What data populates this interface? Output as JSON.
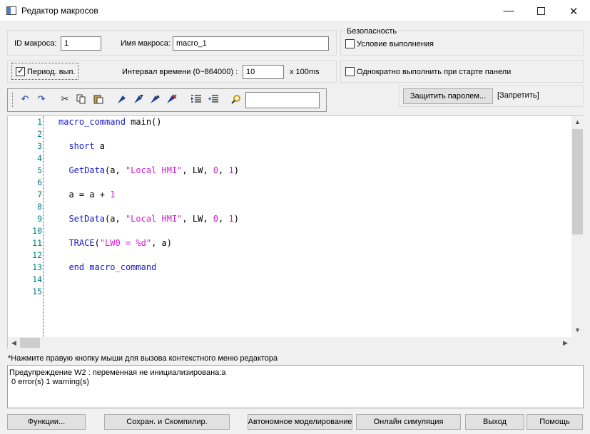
{
  "window": {
    "title": "Редактор макросов",
    "controls": {
      "minimize": "—",
      "close": "✕"
    }
  },
  "macro": {
    "id_label": "ID макроса:",
    "id_value": "1",
    "name_label": "Имя макроса:",
    "name_value": "macro_1",
    "periodic_label": "Период. вып.",
    "periodic_checked": true,
    "interval_label": "Интервал времени (0~864000) :",
    "interval_value": "10",
    "interval_unit": "x 100ms"
  },
  "security": {
    "title": "Безопасность",
    "condition_label": "Условие выполнения",
    "run_once_label": "Однократно выполнить при старте панели",
    "password_button": "Защитить паролем...",
    "status": "[Запретить]"
  },
  "toolbar": {
    "search_value": "",
    "icons": [
      "undo-icon",
      "redo-icon",
      "cut-icon",
      "copy-icon",
      "paste-icon",
      "bookmark-toggle-icon",
      "bookmark-next-icon",
      "bookmark-clear-icon",
      "indent-icon",
      "outdent-icon",
      "find-icon"
    ]
  },
  "editor": {
    "line_numbers": [
      "1",
      "2",
      "3",
      "4",
      "5",
      "6",
      "7",
      "8",
      "9",
      "10",
      "11",
      "12",
      "13",
      "14",
      "15"
    ],
    "lines": [
      "macro_command main()",
      "",
      "  short a",
      "",
      "  GetData(a, \"Local HMI\", LW, 0, 1)",
      "",
      "  a = a + 1",
      "",
      "  SetData(a, \"Local HMI\", LW, 0, 1)",
      "",
      "  TRACE(\"LW0 = %d\", a)",
      "",
      "  end macro_command",
      "",
      ""
    ]
  },
  "hint": "*Нажмите правую кнопку мыши для вызова контекстного меню редактора",
  "output": {
    "line1": "Предупреждение W2 : переменная не инициализирована:a",
    "line2": " 0 error(s) 1 warning(s)"
  },
  "buttons": {
    "functions": "Функции...",
    "save_compile": "Сохран. и Скомпилир.",
    "offline_sim": "Автономное моделирование",
    "online_sim": "Онлайн симуляция",
    "exit": "Выход",
    "help": "Помощь"
  },
  "colors": {
    "keyword": "#1a1acc",
    "string": "#d61ad6",
    "line_number": "#008080"
  }
}
